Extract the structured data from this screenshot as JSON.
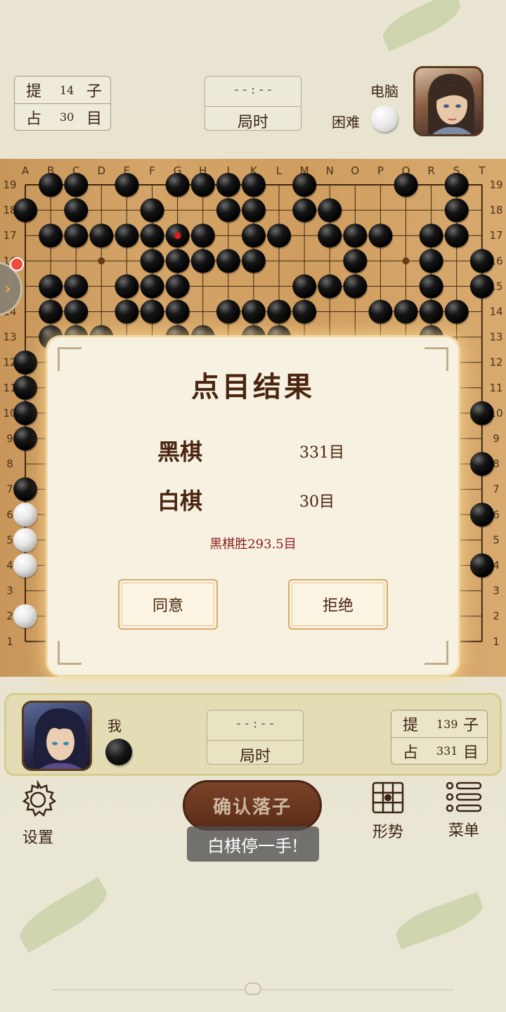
{
  "top_player": {
    "captures_label": "提",
    "captures_value": "14",
    "captures_unit": "子",
    "territory_label": "占",
    "territory_value": "30",
    "territory_unit": "目",
    "timer_value": "- - : - -",
    "timer_label": "局时",
    "name": "电脑",
    "difficulty": "困难",
    "stone_color": "white"
  },
  "board": {
    "columns": [
      "A",
      "B",
      "C",
      "D",
      "E",
      "F",
      "G",
      "H",
      "J",
      "K",
      "L",
      "M",
      "N",
      "O",
      "P",
      "Q",
      "R",
      "S",
      "T"
    ],
    "rows": [
      "19",
      "18",
      "17",
      "16",
      "15",
      "14",
      "13",
      "12",
      "11",
      "10",
      "9",
      "8",
      "7",
      "6",
      "5",
      "4",
      "3",
      "2",
      "1"
    ],
    "last_move": "G17",
    "black_stones": [
      "B19",
      "C19",
      "E19",
      "G19",
      "H19",
      "J19",
      "K19",
      "M19",
      "Q19",
      "S19",
      "A18",
      "C18",
      "F18",
      "J18",
      "K18",
      "M18",
      "N18",
      "S18",
      "B17",
      "C17",
      "D17",
      "E17",
      "F17",
      "G17",
      "H17",
      "K17",
      "L17",
      "N17",
      "O17",
      "P17",
      "R17",
      "S17",
      "F16",
      "G16",
      "H16",
      "J16",
      "K16",
      "O16",
      "R16",
      "T16",
      "B15",
      "C15",
      "E15",
      "F15",
      "G15",
      "M15",
      "N15",
      "O15",
      "R15",
      "T15",
      "B14",
      "C14",
      "E14",
      "F14",
      "G14",
      "J14",
      "K14",
      "L14",
      "M14",
      "P14",
      "Q14",
      "R14",
      "S14",
      "B13",
      "C13",
      "D13",
      "G13",
      "H13",
      "K13",
      "L13",
      "R13",
      "A12",
      "A11",
      "A10",
      "A9",
      "T10",
      "T8",
      "A7",
      "T6",
      "T4"
    ],
    "white_stones": [
      "A6",
      "A5",
      "A4",
      "A2"
    ]
  },
  "dialog": {
    "title": "点目结果",
    "black_label": "黑棋",
    "black_score": "331目",
    "white_label": "白棋",
    "white_score": "30目",
    "verdict": "黑棋胜293.5目",
    "agree_label": "同意",
    "reject_label": "拒绝"
  },
  "bottom_player": {
    "name": "我",
    "stone_color": "black",
    "timer_value": "- - : - -",
    "timer_label": "局时",
    "captures_label": "提",
    "captures_value": "139",
    "captures_unit": "子",
    "territory_label": "占",
    "territory_value": "331",
    "territory_unit": "目"
  },
  "toolbar": {
    "settings_label": "设置",
    "confirm_label": "确认落子",
    "situation_label": "形势",
    "menu_label": "菜单"
  },
  "toast": "白棋停一手!"
}
